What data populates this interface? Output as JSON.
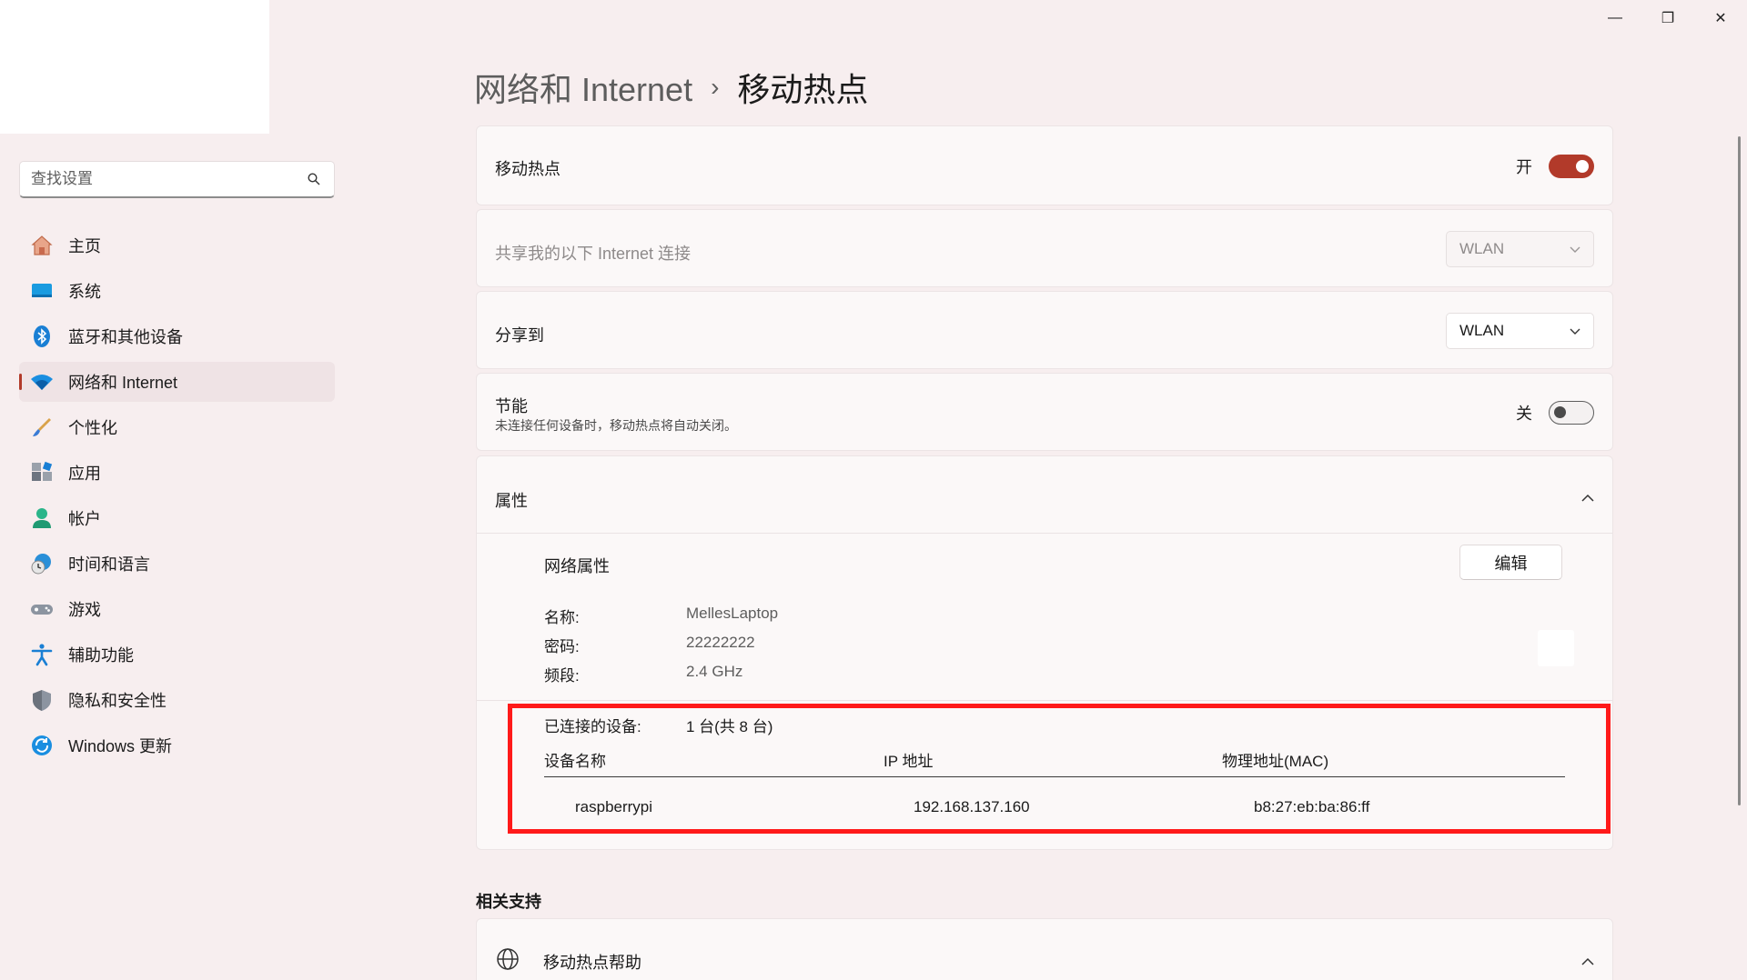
{
  "window": {
    "minimize_glyph": "—",
    "restore_glyph": "❐",
    "close_glyph": "✕"
  },
  "search": {
    "placeholder": "查找设置"
  },
  "sidebar": {
    "items": [
      {
        "label": "主页",
        "icon": "home-icon"
      },
      {
        "label": "系统",
        "icon": "system-icon"
      },
      {
        "label": "蓝牙和其他设备",
        "icon": "bluetooth-icon"
      },
      {
        "label": "网络和 Internet",
        "icon": "wifi-icon",
        "active": true
      },
      {
        "label": "个性化",
        "icon": "brush-icon"
      },
      {
        "label": "应用",
        "icon": "apps-icon"
      },
      {
        "label": "帐户",
        "icon": "account-icon"
      },
      {
        "label": "时间和语言",
        "icon": "time-language-icon"
      },
      {
        "label": "游戏",
        "icon": "gaming-icon"
      },
      {
        "label": "辅助功能",
        "icon": "accessibility-icon"
      },
      {
        "label": "隐私和安全性",
        "icon": "shield-icon"
      },
      {
        "label": "Windows 更新",
        "icon": "update-icon"
      }
    ]
  },
  "breadcrumb": {
    "parent": "网络和 Internet",
    "separator": "›",
    "current": "移动热点"
  },
  "hotspot": {
    "label": "移动热点",
    "state": "开"
  },
  "share_from": {
    "label": "共享我的以下 Internet 连接",
    "value": "WLAN"
  },
  "share_to": {
    "label": "分享到",
    "value": "WLAN"
  },
  "power_saving": {
    "label": "节能",
    "description": "未连接任何设备时，移动热点将自动关闭。",
    "state": "关"
  },
  "properties": {
    "label": "属性",
    "network_props_label": "网络属性",
    "edit_label": "编辑",
    "name_key": "名称:",
    "name_value": "MellesLaptop",
    "password_key": "密码:",
    "password_value": "22222222",
    "band_key": "频段:",
    "band_value": "2.4 GHz",
    "connected_key": "已连接的设备:",
    "connected_value": "1 台(共 8 台)",
    "columns": [
      "设备名称",
      "IP 地址",
      "物理地址(MAC)"
    ],
    "devices": [
      {
        "name": "raspberrypi",
        "ip": "192.168.137.160",
        "mac": "b8:27:eb:ba:86:ff"
      }
    ]
  },
  "related": {
    "title": "相关支持",
    "help_label": "移动热点帮助"
  },
  "colors": {
    "accent": "#b23a2a",
    "highlight": "#ff1a1a",
    "background": "#f7eeef"
  }
}
